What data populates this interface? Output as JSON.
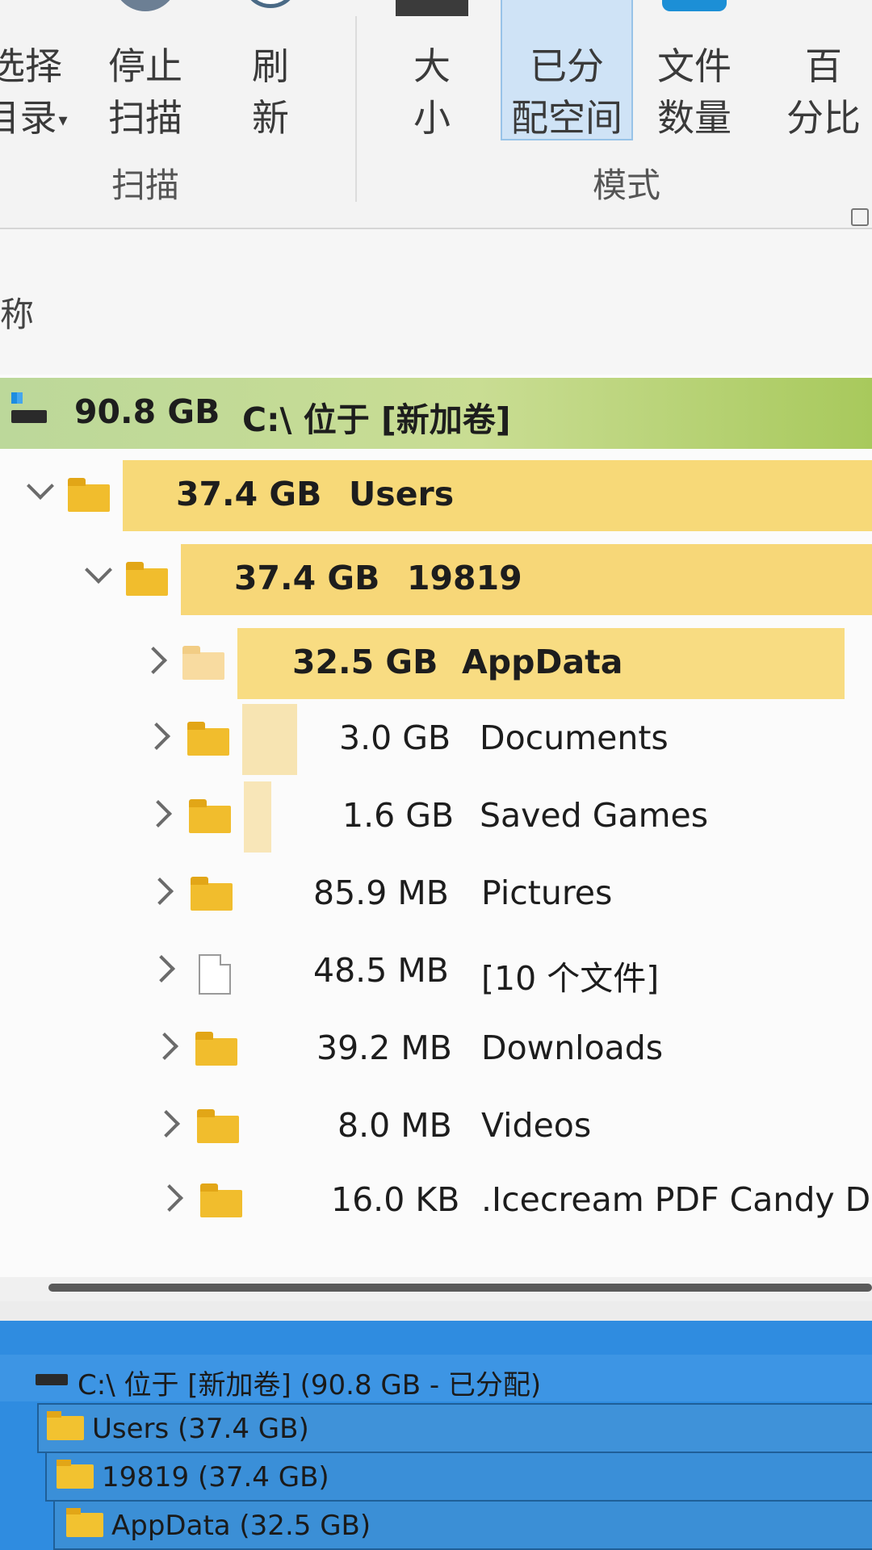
{
  "ribbon": {
    "select_dir": {
      "line1": "选择",
      "line2": "目录"
    },
    "stop_scan": {
      "line1": "停止",
      "line2": "扫描"
    },
    "refresh": {
      "line1": "刷",
      "line2": "新"
    },
    "size": {
      "line1": "大",
      "line2": "小"
    },
    "allocated": {
      "line1": "已分",
      "line2": "配空间"
    },
    "file_count": {
      "line1": "文件",
      "line2": "数量"
    },
    "percent": {
      "line1": "百",
      "line2": "分比"
    },
    "group_scan": "扫描",
    "group_mode": "模式"
  },
  "columns": {
    "name": "称"
  },
  "tree": [
    {
      "size": "90.8 GB",
      "name": "C:\\  位于  [新加卷]",
      "type": "drive",
      "bold": true
    },
    {
      "size": "37.4 GB",
      "name": "Users",
      "type": "folder",
      "expanded": true,
      "bold": true
    },
    {
      "size": "37.4 GB",
      "name": "19819",
      "type": "folder",
      "expanded": true,
      "bold": true
    },
    {
      "size": "32.5 GB",
      "name": "AppData",
      "type": "folder",
      "expanded": false,
      "bold": true
    },
    {
      "size": "3.0 GB",
      "name": "Documents",
      "type": "folder",
      "expanded": false
    },
    {
      "size": "1.6 GB",
      "name": "Saved Games",
      "type": "folder",
      "expanded": false
    },
    {
      "size": "85.9 MB",
      "name": "Pictures",
      "type": "folder",
      "expanded": false
    },
    {
      "size": "48.5 MB",
      "name": "[10 个文件]",
      "type": "file",
      "expanded": false
    },
    {
      "size": "39.2 MB",
      "name": "Downloads",
      "type": "folder",
      "expanded": false
    },
    {
      "size": "8.0 MB",
      "name": "Videos",
      "type": "folder",
      "expanded": false
    },
    {
      "size": "16.0 KB",
      "name": ".Icecream PDF Candy Desktop",
      "type": "folder",
      "expanded": false
    }
  ],
  "treemap": [
    {
      "label": "C:\\  位于  [新加卷] (90.8 GB - 已分配)",
      "icon": "drive-icon"
    },
    {
      "label": "Users (37.4 GB)",
      "icon": "folder-icon"
    },
    {
      "label": "19819 (37.4 GB)",
      "icon": "folder-icon"
    },
    {
      "label": "AppData (32.5 GB)",
      "icon": "folder-icon"
    }
  ],
  "colors": {
    "accent": "#2f8ce0",
    "bar": "#f6d46a",
    "selected": "#cfe3f6"
  }
}
